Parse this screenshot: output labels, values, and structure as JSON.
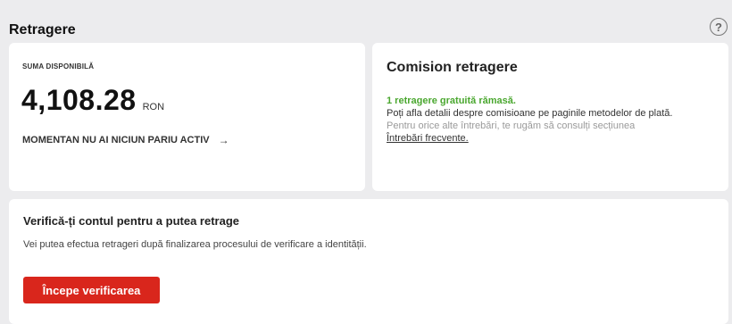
{
  "header": {
    "title": "Retragere",
    "help_icon": "question-circle-icon",
    "help_glyph": "?"
  },
  "balance": {
    "label": "SUMA DISPONIBILĂ",
    "amount": "4,108.28",
    "currency": "RON",
    "link_text": "MOMENTAN NU AI NICIUN PARIU ACTIV",
    "link_icon": "arrow-right-icon",
    "link_glyph": "→"
  },
  "fee": {
    "title": "Comision retragere",
    "free_text": "1 retragere gratuită rămasă.",
    "details_text": "Poți afla detalii despre comisioane pe paginile metodelor de plată.",
    "help_text": "Pentru orice alte întrebări, te rugăm să consulți secțiunea",
    "faq_link": "Întrebări frecvente."
  },
  "verify": {
    "title": "Verifică-ți contul pentru a putea retrage",
    "text": "Vei putea efectua retrageri după finalizarea procesului de verificare a identității.",
    "button_label": "Începe verificarea"
  },
  "colors": {
    "accent_red": "#d9261c",
    "success_green": "#4aa72f",
    "background": "#ececee"
  }
}
